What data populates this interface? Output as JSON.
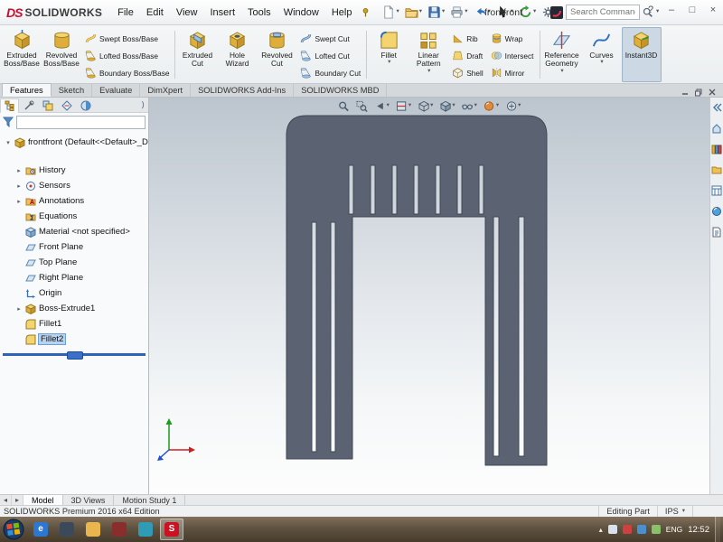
{
  "titlebar": {
    "logo_ds": "DS",
    "logo_text": "SOLIDWORKS",
    "menus": [
      "File",
      "Edit",
      "View",
      "Insert",
      "Tools",
      "Window",
      "Help"
    ],
    "quick_tools": [
      {
        "icon": "new-file-icon",
        "caret": true
      },
      {
        "icon": "open-folder-icon",
        "caret": true
      },
      {
        "icon": "save-icon",
        "caret": true
      },
      {
        "icon": "print-icon",
        "caret": true
      },
      {
        "icon": "undo-icon",
        "caret": true
      },
      {
        "icon": "select-cursor-icon",
        "caret": true
      },
      {
        "icon": "rebuild-icon",
        "caret": true
      },
      {
        "icon": "options-gear-icon",
        "caret": true
      }
    ],
    "doc_title": "frontfront",
    "search": {
      "placeholder": "Search Commands"
    },
    "window_controls": {
      "help": "?",
      "minimize": "–",
      "restore": "□",
      "close": "×"
    }
  },
  "ribbon": {
    "groups": [
      {
        "items": [
          {
            "type": "large",
            "label": "Extruded Boss/Base",
            "icon": "extruded-boss-icon"
          },
          {
            "type": "large",
            "label": "Revolved Boss/Base",
            "icon": "revolved-boss-icon"
          },
          {
            "type": "stack",
            "items": [
              {
                "label": "Swept Boss/Base",
                "icon": "swept-boss-icon"
              },
              {
                "label": "Lofted Boss/Base",
                "icon": "lofted-boss-icon"
              },
              {
                "label": "Boundary Boss/Base",
                "icon": "boundary-boss-icon"
              }
            ]
          }
        ]
      },
      {
        "items": [
          {
            "type": "large",
            "label": "Extruded Cut",
            "icon": "extruded-cut-icon"
          },
          {
            "type": "large",
            "label": "Hole Wizard",
            "icon": "hole-wizard-icon"
          },
          {
            "type": "large",
            "label": "Revolved Cut",
            "icon": "revolved-cut-icon"
          },
          {
            "type": "stack",
            "items": [
              {
                "label": "Swept Cut",
                "icon": "swept-cut-icon"
              },
              {
                "label": "Lofted Cut",
                "icon": "lofted-cut-icon"
              },
              {
                "label": "Boundary Cut",
                "icon": "boundary-cut-icon"
              }
            ]
          }
        ]
      },
      {
        "items": [
          {
            "type": "large",
            "label": "Fillet",
            "icon": "fillet-icon",
            "caret": true
          },
          {
            "type": "large",
            "label": "Linear Pattern",
            "icon": "linear-pattern-icon",
            "caret": true
          },
          {
            "type": "stack",
            "items": [
              {
                "label": "Rib",
                "icon": "rib-icon"
              },
              {
                "label": "Draft",
                "icon": "draft-icon"
              },
              {
                "label": "Shell",
                "icon": "shell-icon"
              }
            ]
          },
          {
            "type": "stack",
            "items": [
              {
                "label": "Wrap",
                "icon": "wrap-icon"
              },
              {
                "label": "Intersect",
                "icon": "intersect-icon"
              },
              {
                "label": "Mirror",
                "icon": "mirror-icon"
              }
            ]
          }
        ]
      },
      {
        "items": [
          {
            "type": "large",
            "label": "Reference Geometry",
            "icon": "reference-geometry-icon",
            "caret": true
          },
          {
            "type": "large",
            "label": "Curves",
            "icon": "curves-icon",
            "caret": true
          },
          {
            "type": "large",
            "label": "Instant3D",
            "icon": "instant3d-icon",
            "active": true
          }
        ]
      }
    ]
  },
  "command_tabs": {
    "tabs": [
      "Features",
      "Sketch",
      "Evaluate",
      "DimXpert",
      "SOLIDWORKS Add-Ins",
      "SOLIDWORKS MBD"
    ],
    "active": "Features",
    "right_icons": [
      "minimize-doc-icon",
      "restore-doc-icon",
      "close-doc-icon"
    ]
  },
  "feature_tree": {
    "panel_tabs": [
      "featuremanager-icon",
      "propertymanager-icon",
      "configurationmanager-icon",
      "dimxpertmanager-icon",
      "displaymanager-icon"
    ],
    "active_panel_tab": 0,
    "filter_value": "",
    "root_label": "frontfront (Default<<Default>_Display",
    "items": [
      {
        "label": "History",
        "icon": "history-icon",
        "expand": true
      },
      {
        "label": "Sensors",
        "icon": "sensors-icon",
        "expand": true
      },
      {
        "label": "Annotations",
        "icon": "annotations-icon",
        "expand": true
      },
      {
        "label": "Equations",
        "icon": "equations-icon",
        "expand": false
      },
      {
        "label": "Material <not specified>",
        "icon": "material-icon",
        "expand": false
      },
      {
        "label": "Front Plane",
        "icon": "plane-icon",
        "expand": false
      },
      {
        "label": "Top Plane",
        "icon": "plane-icon",
        "expand": false
      },
      {
        "label": "Right Plane",
        "icon": "plane-icon",
        "expand": false
      },
      {
        "label": "Origin",
        "icon": "origin-icon",
        "expand": false
      },
      {
        "label": "Boss-Extrude1",
        "icon": "boss-extrude-icon",
        "expand": true
      },
      {
        "label": "Fillet1",
        "icon": "fillet-feature-icon",
        "expand": false
      },
      {
        "label": "Fillet2",
        "icon": "fillet-feature-icon",
        "expand": false,
        "selected": true
      }
    ]
  },
  "headsup": [
    {
      "icon": "zoom-fit-icon",
      "caret": false
    },
    {
      "icon": "zoom-area-icon",
      "caret": false
    },
    {
      "icon": "previous-view-icon",
      "caret": true
    },
    {
      "icon": "section-view-icon",
      "caret": true
    },
    {
      "icon": "view-orientation-icon",
      "caret": true
    },
    {
      "icon": "display-style-icon",
      "caret": true
    },
    {
      "icon": "hide-show-items-icon",
      "caret": true
    },
    {
      "icon": "edit-appearance-icon",
      "caret": true
    },
    {
      "icon": "view-settings-icon",
      "caret": true
    }
  ],
  "taskpane_icons": [
    "collapse-arrow-icon",
    "solidworks-resources-icon",
    "design-library-icon",
    "file-explorer-icon",
    "view-palette-icon",
    "appearances-icon",
    "custom-properties-icon"
  ],
  "viewport": {
    "model_color": "#5b6373",
    "model_edge_color": "#3f4654",
    "triad": {
      "x_color": "#cc2020",
      "y_color": "#1e9a1e",
      "z_color": "#2050cc"
    }
  },
  "doc_tabs": {
    "tabs": [
      {
        "label": "Model",
        "active": true
      },
      {
        "label": "3D Views",
        "active": false
      },
      {
        "label": "Motion Study 1",
        "active": false
      }
    ]
  },
  "statusbar": {
    "product": "SOLIDWORKS Premium 2016 x64 Edition",
    "mode": "Editing Part",
    "units": "IPS"
  },
  "taskbar": {
    "apps": [
      {
        "name": "browser",
        "color": "#2e77d0",
        "glyph": "e",
        "active": false
      },
      {
        "name": "app-dark",
        "color": "#3b4a5a",
        "glyph": "",
        "active": false
      },
      {
        "name": "file-explorer",
        "color": "#e8b64c",
        "glyph": "",
        "active": false
      },
      {
        "name": "app-maroon",
        "color": "#8a2d2d",
        "glyph": "",
        "active": false
      },
      {
        "name": "app-teal",
        "color": "#2f9bb5",
        "glyph": "",
        "active": false
      },
      {
        "name": "solidworks",
        "color": "#cc1122",
        "glyph": "S",
        "active": true
      }
    ],
    "lang": "ENG",
    "time": "12:52"
  },
  "colors": {
    "brand_red": "#c8102e",
    "selection_blue": "#b9d3ee",
    "rollback_blue": "#2f62b8",
    "taskbar_brown": "#5f5240"
  }
}
